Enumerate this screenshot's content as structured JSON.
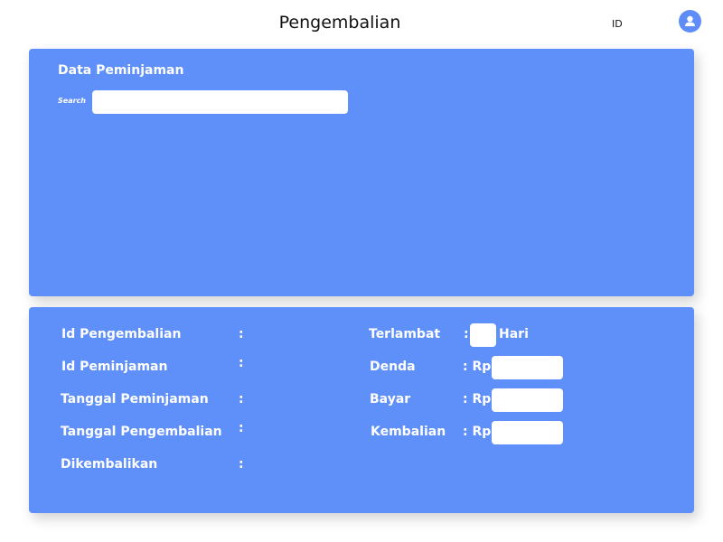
{
  "header": {
    "title": "Pengembalian",
    "language": "ID",
    "avatar_icon": "user-icon"
  },
  "loan_panel": {
    "title": "Data Peminjaman",
    "search_label": "Search",
    "search_value": "",
    "search_placeholder": ""
  },
  "return_panel": {
    "left_fields": [
      {
        "label": "Id Pengembalian",
        "colon": ":"
      },
      {
        "label": "Id Peminjaman",
        "colon": ":"
      },
      {
        "label": "Tanggal Peminjaman",
        "colon": ":"
      },
      {
        "label": "Tanggal Pengembalian",
        "colon": ":"
      },
      {
        "label": "Dikembalikan",
        "colon": ":"
      }
    ],
    "late": {
      "label": "Terlambat",
      "colon": ":",
      "value": "",
      "unit": "Hari"
    },
    "fine": {
      "label": "Denda",
      "prefix": ": Rp",
      "value": ""
    },
    "pay": {
      "label": "Bayar",
      "prefix": ": Rp",
      "value": ""
    },
    "change": {
      "label": "Kembalian",
      "prefix": ": Rp",
      "value": ""
    }
  },
  "colors": {
    "panel": "#5f8ff8",
    "avatar": "#5f8df7",
    "text_on_panel": "#ffffff"
  }
}
